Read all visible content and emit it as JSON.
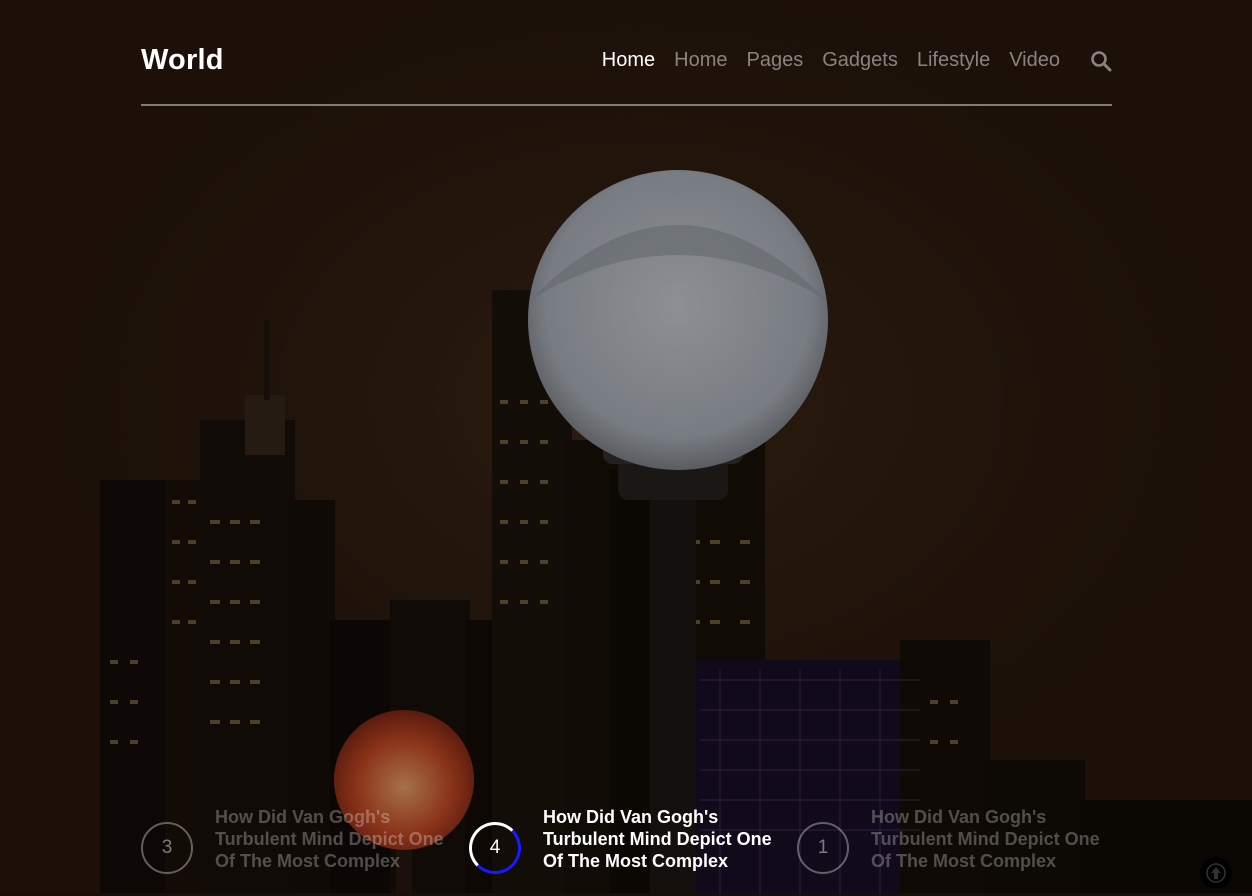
{
  "header": {
    "logo": "World",
    "nav": [
      "Home",
      "Home",
      "Pages",
      "Gadgets",
      "Lifestyle",
      "Video"
    ],
    "search_icon": "search-icon"
  },
  "slider": {
    "items": [
      {
        "number": "3",
        "title": "How Did Van Gogh's Turbulent Mind Depict One Of The Most Complex",
        "active": false
      },
      {
        "number": "4",
        "title": "How Did Van Gogh's Turbulent Mind Depict One Of The Most Complex",
        "active": true
      },
      {
        "number": "1",
        "title": "How Did Van Gogh's Turbulent Mind Depict One Of The Most Complex",
        "active": false
      }
    ]
  },
  "colors": {
    "accent": "#1a1aff",
    "nav_inactive": "#8a8380",
    "nav_active": "#ffffff"
  },
  "back_to_top_icon": "arrow-up-icon"
}
